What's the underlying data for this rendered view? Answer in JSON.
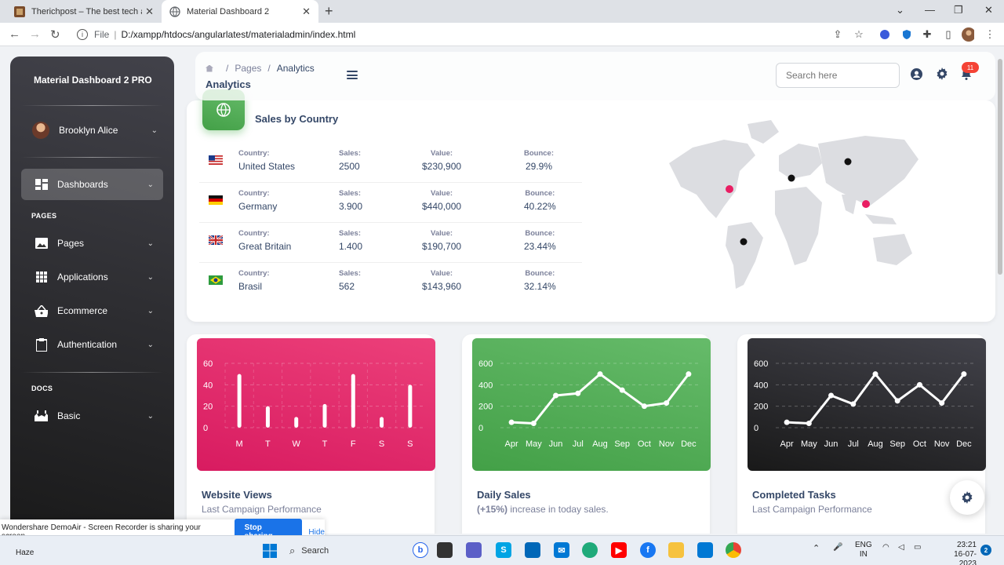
{
  "browser": {
    "tabs": [
      {
        "title": "Therichpost – The best tech and",
        "active": false
      },
      {
        "title": "Material Dashboard 2",
        "active": true
      }
    ],
    "url_scheme": "File",
    "url": "D:/xampp/htdocs/angularlatest/materialadmin/index.html"
  },
  "sidebar": {
    "brand": "Material Dashboard 2 PRO",
    "user": "Brooklyn Alice",
    "dashboards": "Dashboards",
    "heading_pages": "PAGES",
    "items": [
      {
        "label": "Pages",
        "icon": "image-icon"
      },
      {
        "label": "Applications",
        "icon": "apps-icon"
      },
      {
        "label": "Ecommerce",
        "icon": "basket-icon"
      },
      {
        "label": "Authentication",
        "icon": "clipboard-icon"
      }
    ],
    "heading_docs": "DOCS",
    "basic": "Basic"
  },
  "topnav": {
    "breadcrumb": [
      "Pages",
      "Analytics"
    ],
    "title": "Analytics",
    "search_placeholder": "Search here",
    "notification_count": "11"
  },
  "sales_by_country": {
    "title": "Sales by Country",
    "labels": {
      "country": "Country:",
      "sales": "Sales:",
      "value": "Value:",
      "bounce": "Bounce:"
    },
    "rows": [
      {
        "country": "United States",
        "sales": "2500",
        "value": "$230,900",
        "bounce": "29.9%",
        "flag": "us"
      },
      {
        "country": "Germany",
        "sales": "3.900",
        "value": "$440,000",
        "bounce": "40.22%",
        "flag": "de"
      },
      {
        "country": "Great Britain",
        "sales": "1.400",
        "value": "$190,700",
        "bounce": "23.44%",
        "flag": "gb"
      },
      {
        "country": "Brasil",
        "sales": "562",
        "value": "$143,960",
        "bounce": "32.14%",
        "flag": "br"
      }
    ]
  },
  "cards": [
    {
      "title": "Website Views",
      "subtitle": "Last Campaign Performance",
      "color": "#e91e63"
    },
    {
      "title": "Daily Sales",
      "subtitle_bold": "(+15%)",
      "subtitle": " increase in today sales.",
      "color": "#4caf50"
    },
    {
      "title": "Completed Tasks",
      "subtitle": "Last Campaign Performance",
      "color": "#262626"
    }
  ],
  "chart_data": [
    {
      "type": "bar",
      "categories": [
        "M",
        "T",
        "W",
        "T",
        "F",
        "S",
        "S"
      ],
      "values": [
        50,
        20,
        10,
        22,
        50,
        10,
        40
      ],
      "ylim": [
        0,
        60
      ],
      "yticks": [
        "60",
        "40",
        "20",
        "0"
      ],
      "color": "#ffffff"
    },
    {
      "type": "line",
      "categories": [
        "Apr",
        "May",
        "Jun",
        "Jul",
        "Aug",
        "Sep",
        "Oct",
        "Nov",
        "Dec"
      ],
      "values": [
        50,
        40,
        300,
        320,
        500,
        350,
        200,
        230,
        500
      ],
      "ylim": [
        0,
        600
      ],
      "yticks": [
        "600",
        "400",
        "200",
        "0"
      ],
      "color": "#ffffff"
    },
    {
      "type": "line",
      "categories": [
        "Apr",
        "May",
        "Jun",
        "Jul",
        "Aug",
        "Sep",
        "Oct",
        "Nov",
        "Dec"
      ],
      "values": [
        50,
        40,
        300,
        220,
        500,
        250,
        400,
        230,
        500
      ],
      "ylim": [
        0,
        600
      ],
      "yticks": [
        "600",
        "400",
        "200",
        "0"
      ],
      "color": "#ffffff"
    }
  ],
  "sharebar": {
    "message": "Wondershare DemoAir - Screen Recorder is sharing your screen.",
    "stop": "Stop sharing",
    "hide": "Hide"
  },
  "taskbar": {
    "weather_temp": "",
    "weather": "Haze",
    "search": "Search",
    "lang1": "ENG",
    "lang2": "IN",
    "time": "23:21",
    "date": "16-07-2023",
    "notif": "2"
  }
}
